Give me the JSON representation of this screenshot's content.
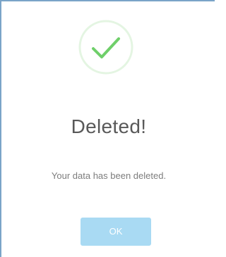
{
  "dialog": {
    "icon": "success-checkmark-icon",
    "title": "Deleted!",
    "message": "Your data has been deleted.",
    "confirm_label": "OK"
  },
  "colors": {
    "success": "#6fcf6a",
    "success_ring": "#e4f5e2",
    "button": "#a9daf3",
    "title": "#595959",
    "message": "#7d7d7d",
    "border": "#7aa4c8"
  }
}
